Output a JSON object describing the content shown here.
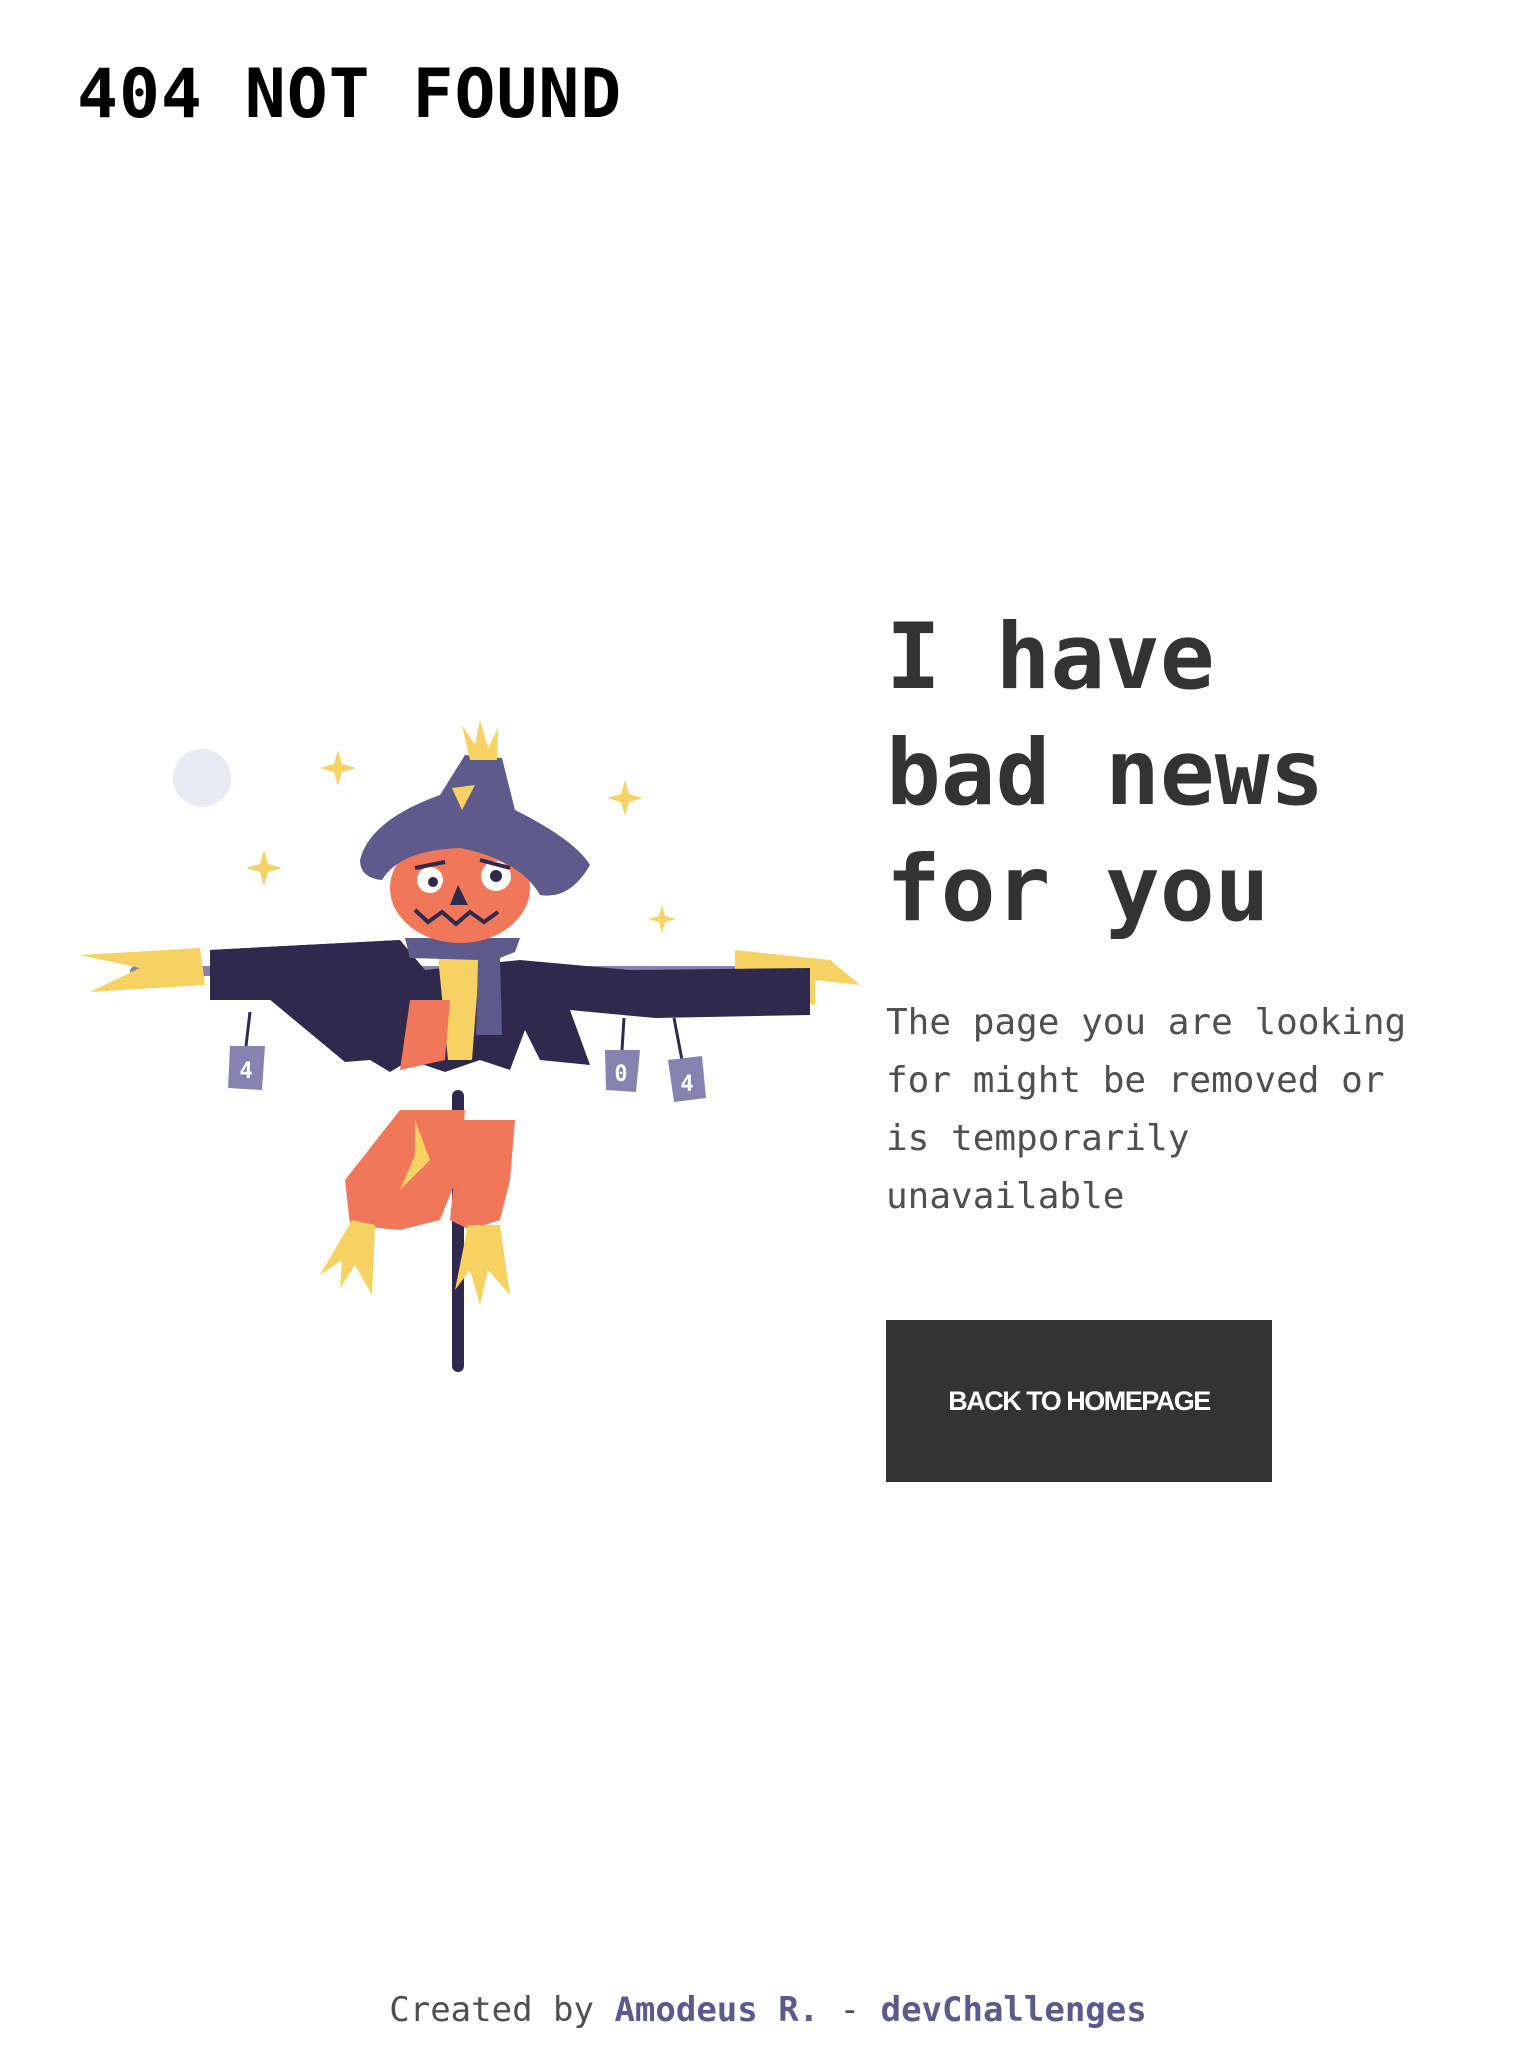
{
  "header": {
    "title": "404 NOT FOUND"
  },
  "main": {
    "headline_lines": [
      "I have",
      "bad news",
      "for you"
    ],
    "description_lines": [
      "The page you are looking",
      "for might be removed or",
      "is temporarily",
      "unavailable"
    ],
    "button_label": "BACK TO HOMEPAGE"
  },
  "illustration": {
    "subject": "scarecrow",
    "cans": [
      "4",
      "0",
      "4"
    ]
  },
  "footer": {
    "created_by": "Created by",
    "author": "Amodeus R.",
    "separator": "-",
    "site": "devChallenges"
  },
  "colors": {
    "text_dark": "#333333",
    "title": "#000000",
    "button_bg": "#333333",
    "button_text": "#ffffff",
    "link": "#5b5a8c",
    "hat": "#5f5a8c",
    "coat": "#2f2a4d",
    "skin": "#f0775a",
    "straw": "#f6d263",
    "can": "#8782b0",
    "moon": "#e9eaf4"
  }
}
